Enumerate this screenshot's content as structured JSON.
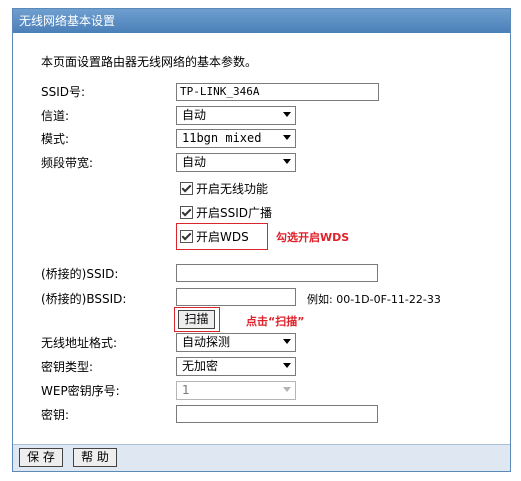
{
  "title": "无线网络基本设置",
  "description": "本页面设置路由器无线网络的基本参数。",
  "fields": {
    "ssid": {
      "label": "SSID号:",
      "value": "TP-LINK_346A"
    },
    "channel": {
      "label": "信道:",
      "value": "自动"
    },
    "mode": {
      "label": "模式:",
      "value": "11bgn mixed"
    },
    "bandwidth": {
      "label": "频段带宽:",
      "value": "自动"
    }
  },
  "checkboxes": {
    "wireless": "开启无线功能",
    "ssid_broadcast": "开启SSID广播",
    "wds": "开启WDS"
  },
  "annotations": {
    "wds_hint": "勾选开启WDS",
    "scan_hint": "点击“扫描”"
  },
  "bridge": {
    "ssid_label": "(桥接的)SSID:",
    "ssid_value": "",
    "bssid_label": "(桥接的)BSSID:",
    "bssid_value": "",
    "example": "例如: 00-1D-0F-11-22-33",
    "scan_button": "扫描"
  },
  "security": {
    "address_format_label": "无线地址格式:",
    "address_format_value": "自动探测",
    "key_type_label": "密钥类型:",
    "key_type_value": "无加密",
    "wep_index_label": "WEP密钥序号:",
    "wep_index_value": "1",
    "key_label": "密钥:",
    "key_value": ""
  },
  "footer": {
    "save_button": "保 存",
    "help_button": "帮 助"
  },
  "colors": {
    "title_bar": "#4a7fb8",
    "annotation": "#e0202a",
    "footer_bg": "#dfe7f2"
  }
}
